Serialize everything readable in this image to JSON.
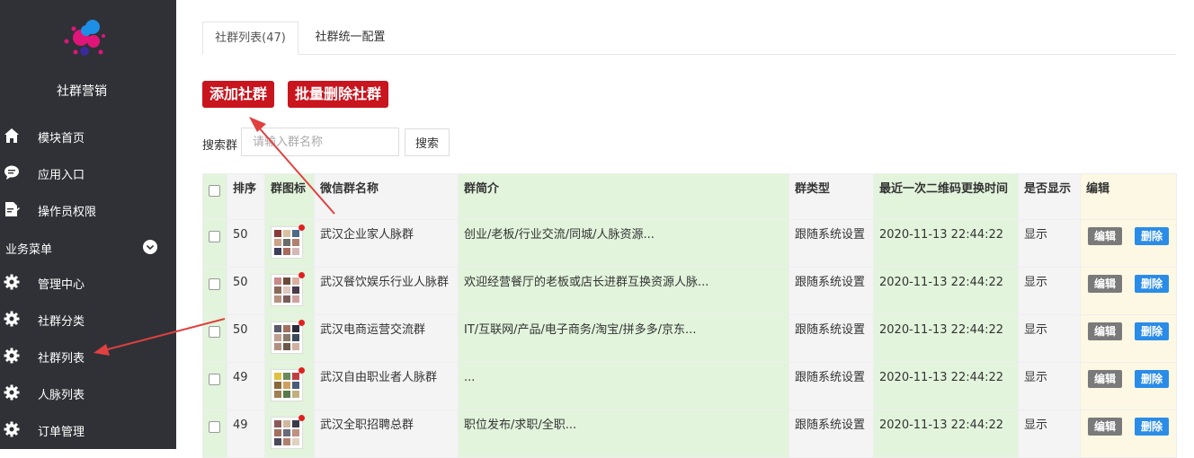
{
  "sidebar": {
    "brand": "社群营销",
    "items": [
      {
        "label": "模块首页",
        "icon": "home-icon"
      },
      {
        "label": "应用入口",
        "icon": "chat-bubble-icon"
      },
      {
        "label": "操作员权限",
        "icon": "document-edit-icon"
      }
    ],
    "section": {
      "label": "业务菜单",
      "icon": "chevron-down-icon"
    },
    "sub_items": [
      {
        "label": "管理中心",
        "icon": "gear-icon"
      },
      {
        "label": "社群分类",
        "icon": "gear-icon"
      },
      {
        "label": "社群列表",
        "icon": "gear-icon"
      },
      {
        "label": "人脉列表",
        "icon": "gear-icon"
      },
      {
        "label": "订单管理",
        "icon": "gear-icon"
      }
    ]
  },
  "tabs": [
    {
      "label": "社群列表(47)",
      "active": true
    },
    {
      "label": "社群统一配置",
      "active": false
    }
  ],
  "toolbar": {
    "add_label": "添加社群",
    "batch_delete_label": "批量删除社群"
  },
  "search": {
    "label": "搜索群",
    "placeholder": "请输入群名称",
    "button_label": "搜索"
  },
  "table": {
    "headers": [
      "排序",
      "群图标",
      "微信群名称",
      "群简介",
      "群类型",
      "最近一次二维码更换时间",
      "是否显示",
      "编辑"
    ],
    "edit_label": "编辑",
    "delete_label": "删除",
    "rows": [
      {
        "sort": "50",
        "name": "武汉企业家人脉群",
        "intro": "创业/老板/行业交流/同城/人脉资源...",
        "type": "跟随系统设置",
        "time": "2020-11-13 22:44:22",
        "show": "显示"
      },
      {
        "sort": "50",
        "name": "武汉餐饮娱乐行业人脉群",
        "intro": "欢迎经营餐厅的老板或店长进群互换资源人脉...",
        "type": "跟随系统设置",
        "time": "2020-11-13 22:44:22",
        "show": "显示"
      },
      {
        "sort": "50",
        "name": "武汉电商运营交流群",
        "intro": "IT/互联网/产品/电子商务/淘宝/拼多多/京东...",
        "type": "跟随系统设置",
        "time": "2020-11-13 22:44:22",
        "show": "显示"
      },
      {
        "sort": "49",
        "name": "武汉自由职业者人脉群",
        "intro": "...",
        "type": "跟随系统设置",
        "time": "2020-11-13 22:44:22",
        "show": "显示"
      },
      {
        "sort": "49",
        "name": "武汉全职招聘总群",
        "intro": "职位发布/求职/全职...",
        "type": "跟随系统设置",
        "time": "2020-11-13 22:44:22",
        "show": "显示"
      }
    ]
  },
  "colors": {
    "sidebar_bg": "#2f3136",
    "accent_red": "#c9151e",
    "delete_blue": "#2b8ce8",
    "edit_gray": "#7a7a7a",
    "cell_green": "#e2f4dc",
    "cell_cream": "#fdf8e4",
    "annotation_arrow": "#e04040"
  }
}
